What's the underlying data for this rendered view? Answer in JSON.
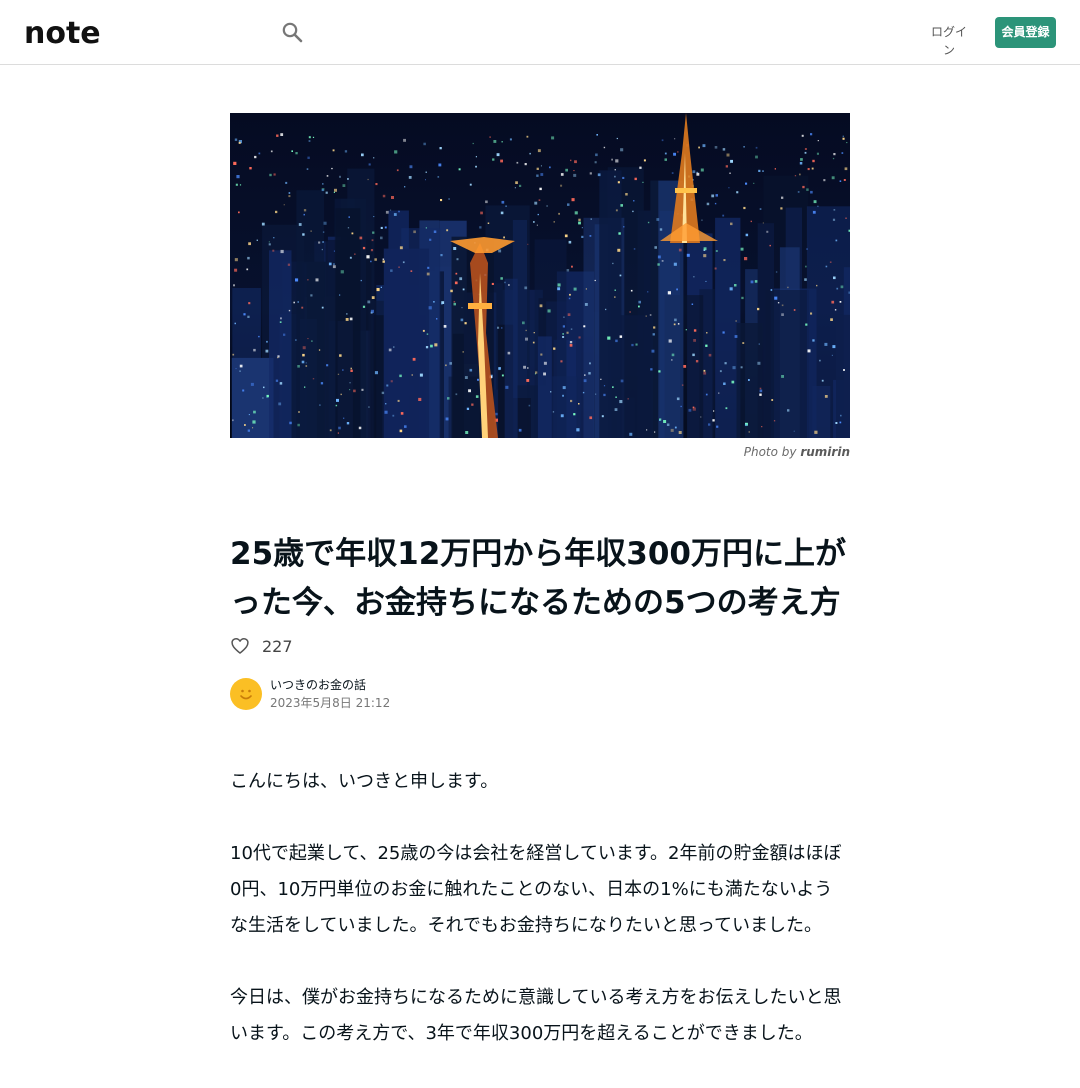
{
  "header": {
    "logo_text": "note",
    "login_label": "ログイン",
    "register_label": "会員登録"
  },
  "hero": {
    "credit_prefix": "Photo by",
    "credit_author": "rumirin"
  },
  "article": {
    "title": "25歳で年収12万円から年収300万円に上がった今、お金持ちになるための5つの考え方",
    "likes": "227",
    "author_name": "いつきのお金の話",
    "date": "2023年5月8日 21:12",
    "paragraphs": [
      "こんにちは、いつきと申します。",
      "10代で起業して、25歳の今は会社を経営しています。2年前の貯金額はほぼ0円、10万円単位のお金に触れたことのない、日本の1%にも満たないような生活をしていました。それでもお金持ちになりたいと思っていました。",
      "今日は、僕がお金持ちになるために意識している考え方をお伝えしたいと思います。この考え方で、3年で年収300万円を超えることができました。"
    ]
  },
  "colors": {
    "accent": "#2c9479",
    "text": "#08131a"
  }
}
